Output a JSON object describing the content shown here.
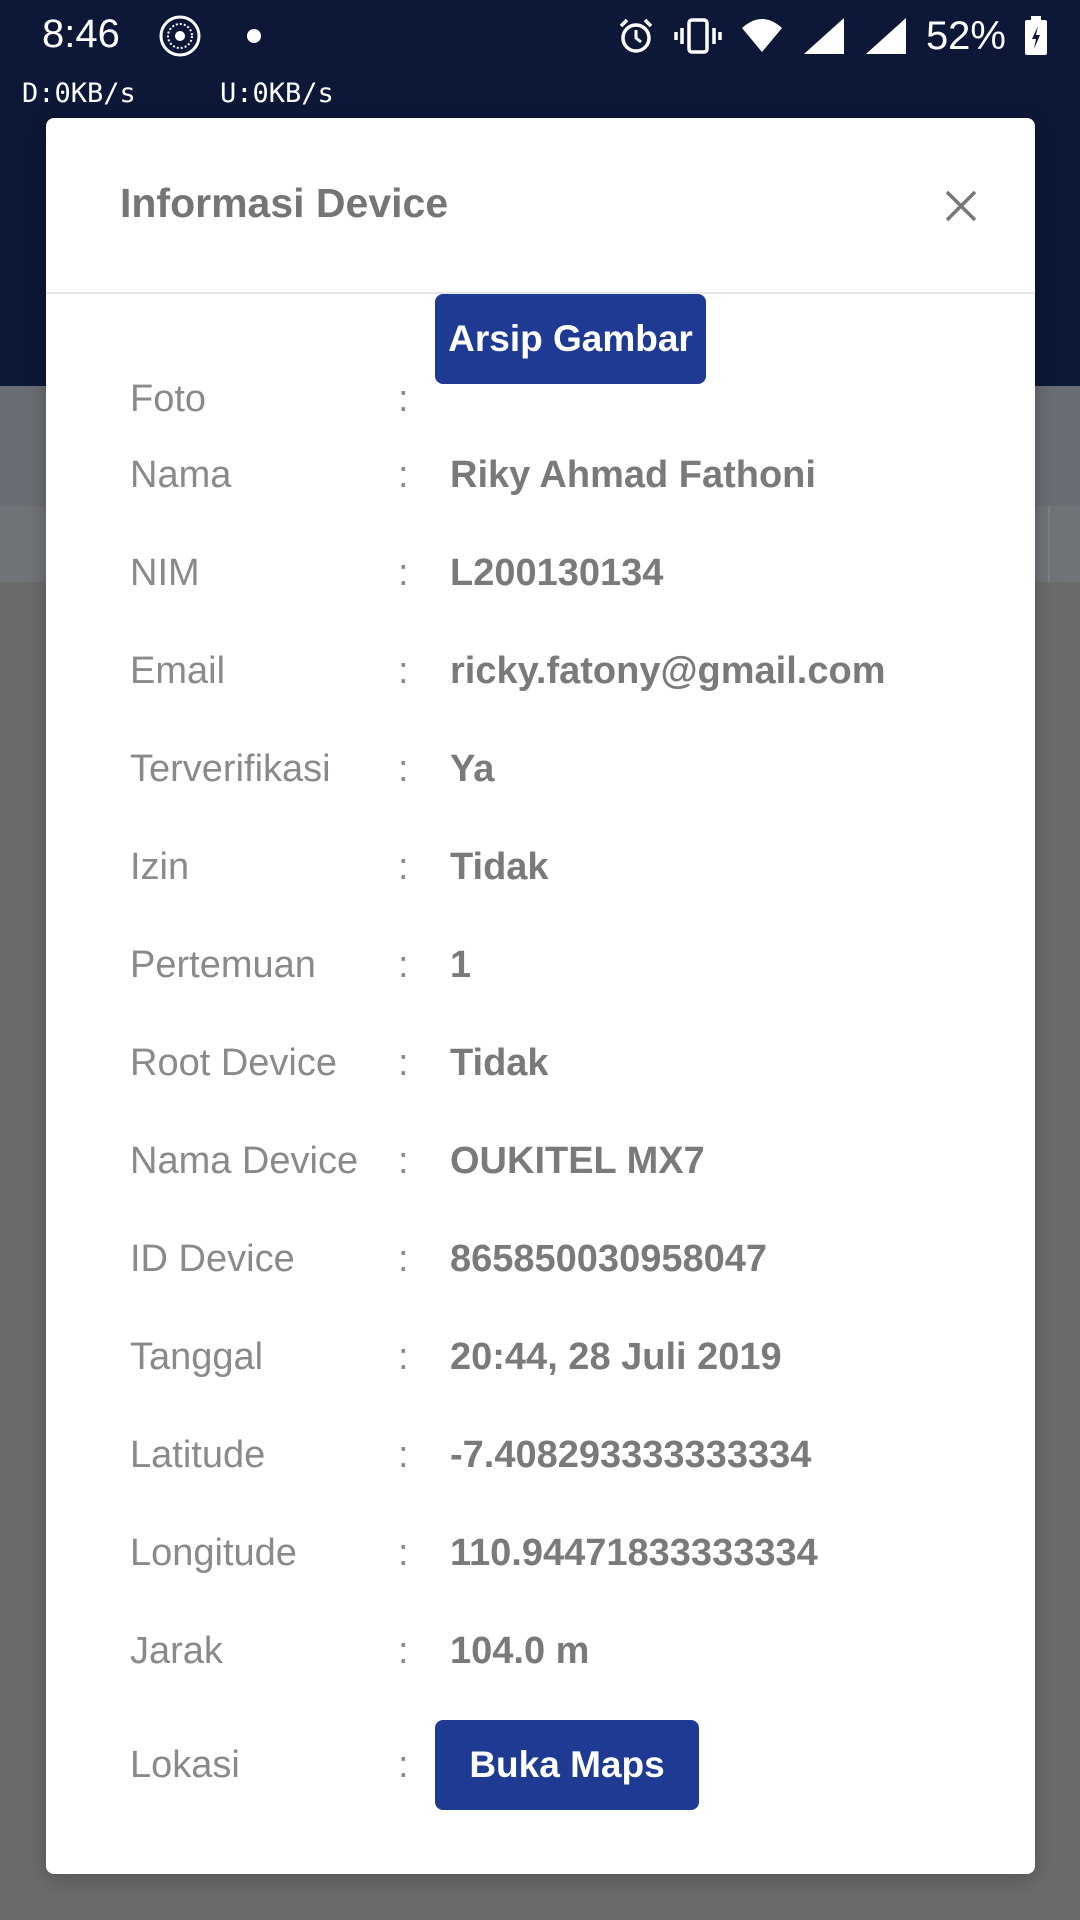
{
  "status_bar": {
    "time": "8:46",
    "battery_percent": "52%",
    "download": "D:0KB/s",
    "upload": "U:0KB/s"
  },
  "modal": {
    "title": "Informasi Device",
    "rows": [
      {
        "label": "Foto",
        "colon": ":",
        "button": "Arsip Gambar"
      },
      {
        "label": "Nama",
        "colon": ":",
        "value": "Riky Ahmad Fathoni"
      },
      {
        "label": "NIM",
        "colon": ":",
        "value": "L200130134"
      },
      {
        "label": "Email",
        "colon": ":",
        "value": "ricky.fatony@gmail.com"
      },
      {
        "label": "Terverifikasi",
        "colon": ":",
        "value": "Ya"
      },
      {
        "label": "Izin",
        "colon": ":",
        "value": "Tidak"
      },
      {
        "label": "Pertemuan",
        "colon": ":",
        "value": "1"
      },
      {
        "label": "Root Device",
        "colon": ":",
        "value": "Tidak"
      },
      {
        "label": "Nama Device",
        "colon": ":",
        "value": "OUKITEL MX7"
      },
      {
        "label": "ID Device",
        "colon": ":",
        "value": "865850030958047"
      },
      {
        "label": "Tanggal",
        "colon": ":",
        "value": "20:44, 28 Juli 2019"
      },
      {
        "label": "Latitude",
        "colon": ":",
        "value": "-7.408293333333334"
      },
      {
        "label": "Longitude",
        "colon": ":",
        "value": "110.94471833333334"
      },
      {
        "label": "Jarak",
        "colon": ":",
        "value": "104.0 m"
      },
      {
        "label": "Lokasi",
        "colon": ":",
        "button": "Buka Maps"
      }
    ]
  },
  "colors": {
    "primary": "#1f3a93",
    "status_bar": "#0d1838"
  },
  "icons": [
    "seal-icon",
    "alarm-icon",
    "vibrate-icon",
    "wifi-icon",
    "signal-icon",
    "battery-icon",
    "close-icon"
  ]
}
